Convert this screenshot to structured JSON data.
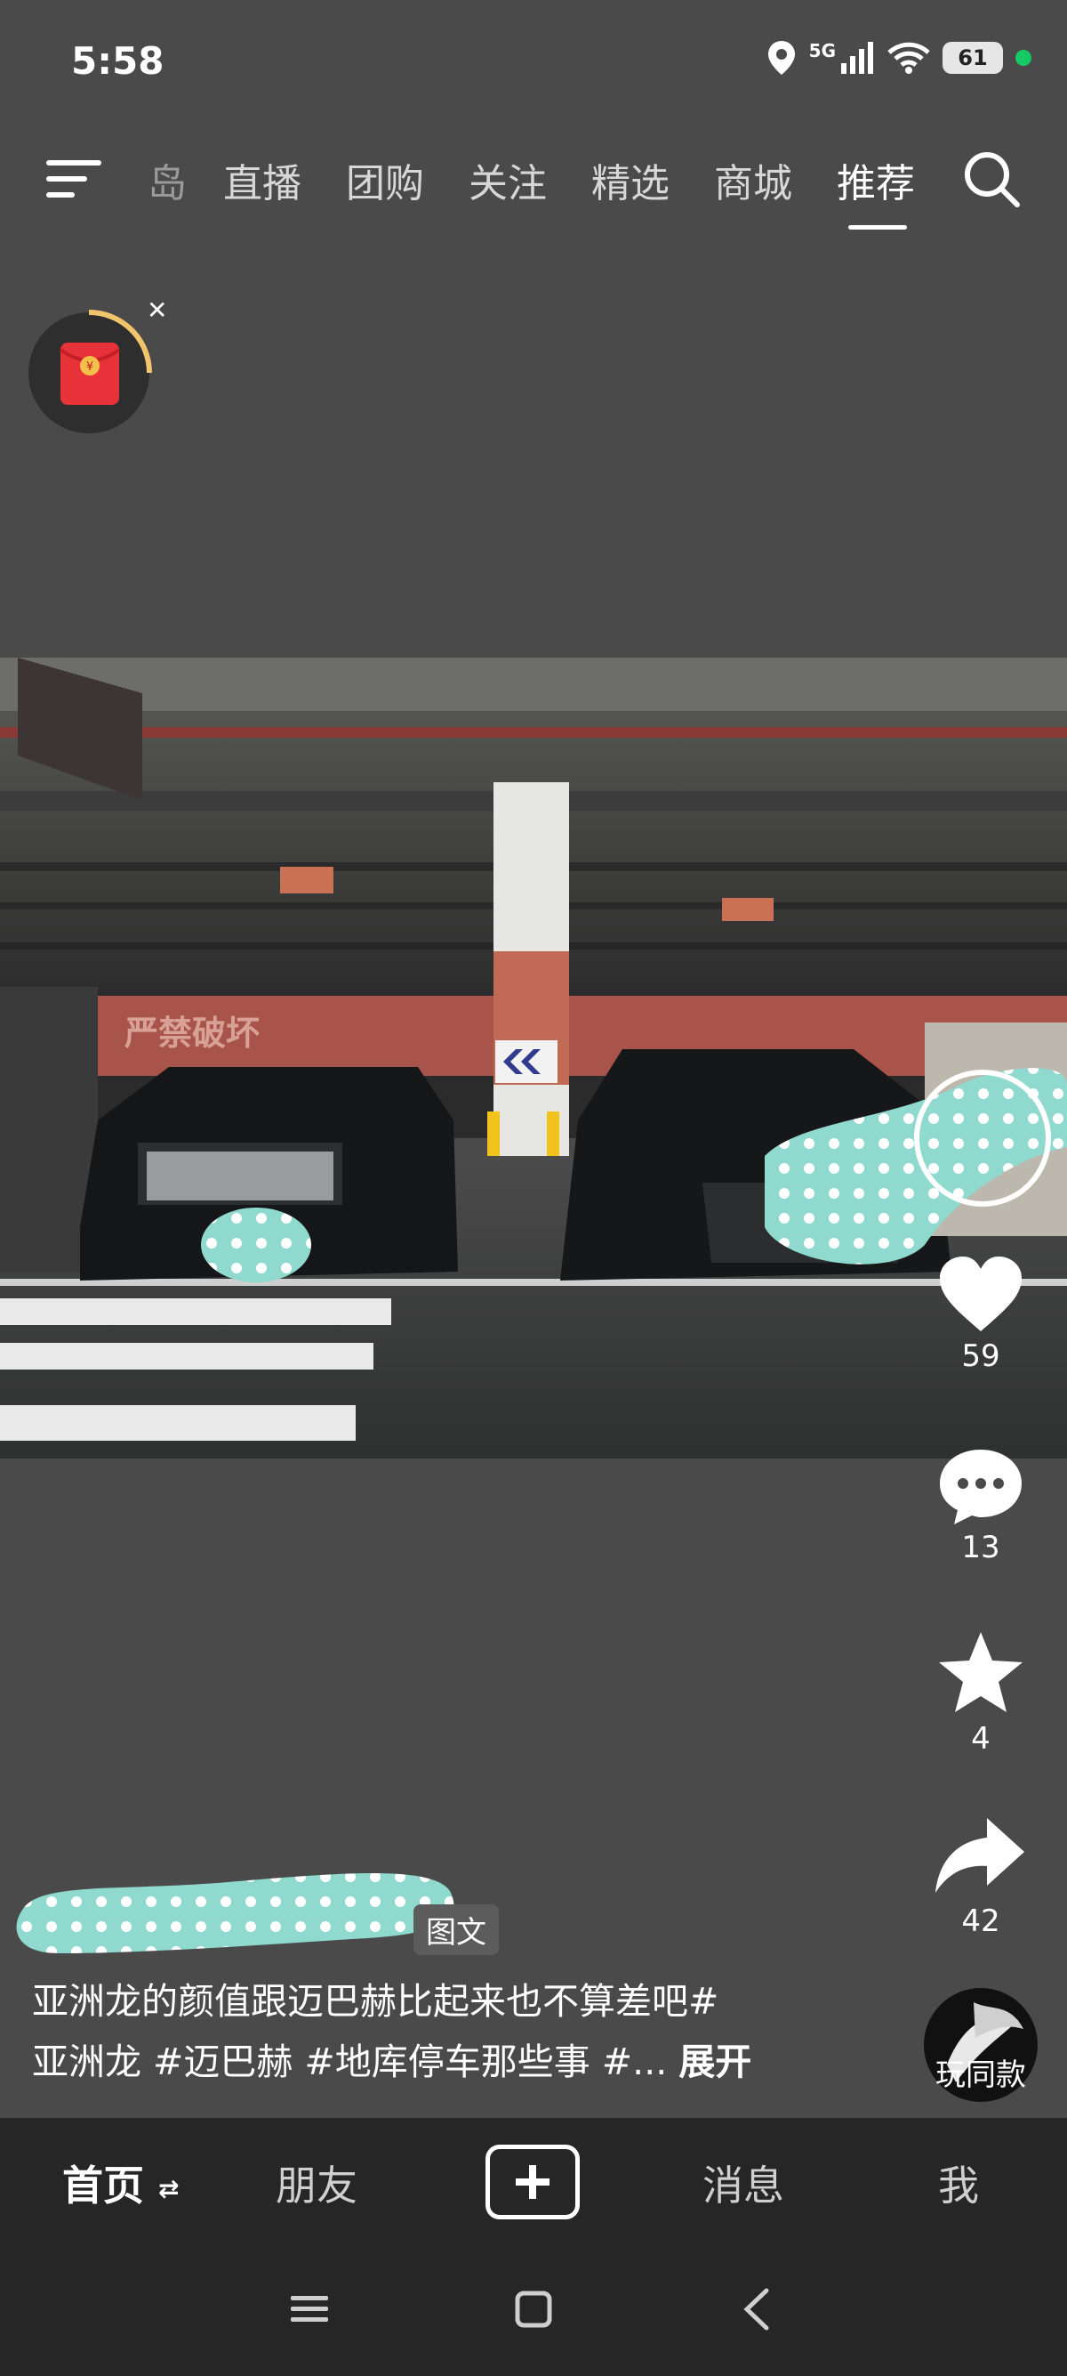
{
  "status_bar": {
    "time": "5:58",
    "network": "5G",
    "battery": "61",
    "icons": [
      "location-icon",
      "signal-icon",
      "wifi-icon",
      "battery-icon"
    ]
  },
  "top_nav": {
    "tabs": [
      "岛",
      "直播",
      "团购",
      "关注",
      "精选",
      "商城",
      "推荐"
    ],
    "active_tab": "推荐"
  },
  "video": {
    "tag_label": "图文",
    "caption_line1": "亚洲龙的颜值跟迈巴赫比起来也不算差吧#",
    "caption_line2": "亚洲龙 #迈巴赫 #地库停车那些事 #...",
    "expand_label": "展开",
    "parking_sign_text": "严禁破坏"
  },
  "actions": {
    "like_count": "59",
    "comment_count": "13",
    "favorite_count": "4",
    "share_count": "42",
    "same_style_label": "玩同款"
  },
  "bottom_nav": {
    "home": "首页",
    "friends": "朋友",
    "messages": "消息",
    "me": "我"
  },
  "colors": {
    "background": "#4a4a4a",
    "bottom_bar": "#262626",
    "redpack": "#e8323a",
    "privacy_blob": "#8fd9cf"
  }
}
